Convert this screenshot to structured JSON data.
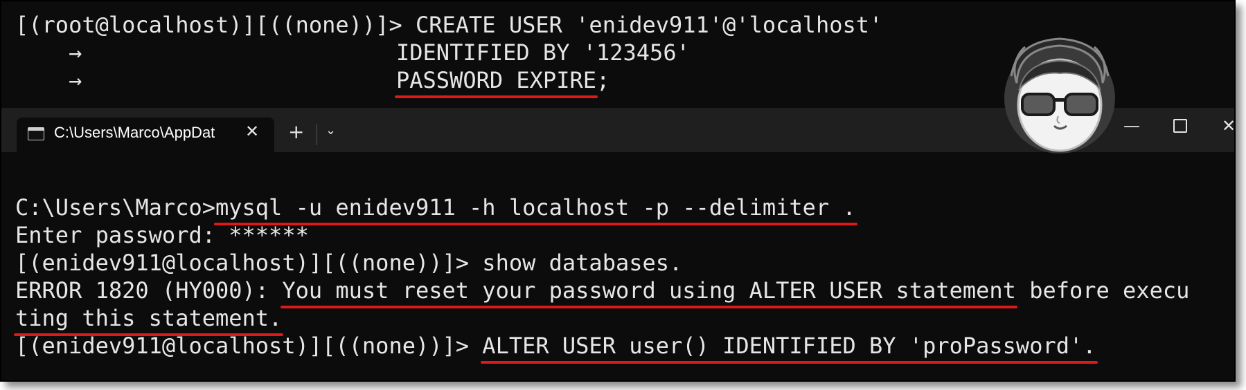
{
  "top_terminal": {
    "line1": "[(root@localhost)][((none))]> CREATE USER 'enidev911'@'localhost'",
    "line2_arrow": "    →",
    "line2_text": "IDENTIFIED BY '123456'",
    "line3_arrow": "    →",
    "line3_text": "PASSWORD EXPIRE",
    "line3_suffix": ";"
  },
  "titlebar": {
    "tab_title": "C:\\Users\\Marco\\AppDat",
    "tab_close": "✕",
    "new_tab": "+",
    "dropdown": "⌄",
    "minimize": "—",
    "close": "✕"
  },
  "main_terminal": {
    "l1_prompt": "C:\\Users\\Marco>",
    "l1_cmd": "mysql -u enidev911 -h localhost -p --delimiter .",
    "l2": "Enter password: ******",
    "l3": "[(enidev911@localhost)][((none))]> show databases.",
    "l4_prefix": "ERROR 1820 (HY000): ",
    "l4_ul": "You must reset your password using ALTER USER statement",
    "l4_suffix": " before execu",
    "l5_ul": "ting this statement.",
    "l6_prompt": "[(enidev911@localhost)][((none))]> ",
    "l6_cmd": "ALTER USER user() IDENTIFIED BY 'proPassword'."
  },
  "icons": {
    "terminal": "terminal-icon",
    "avatar": "avatar-sunglasses"
  },
  "colors": {
    "background": "#0c0c0c",
    "text": "#e6e6e6",
    "underline": "#e01818",
    "titlebar": "#1f1f1f"
  }
}
